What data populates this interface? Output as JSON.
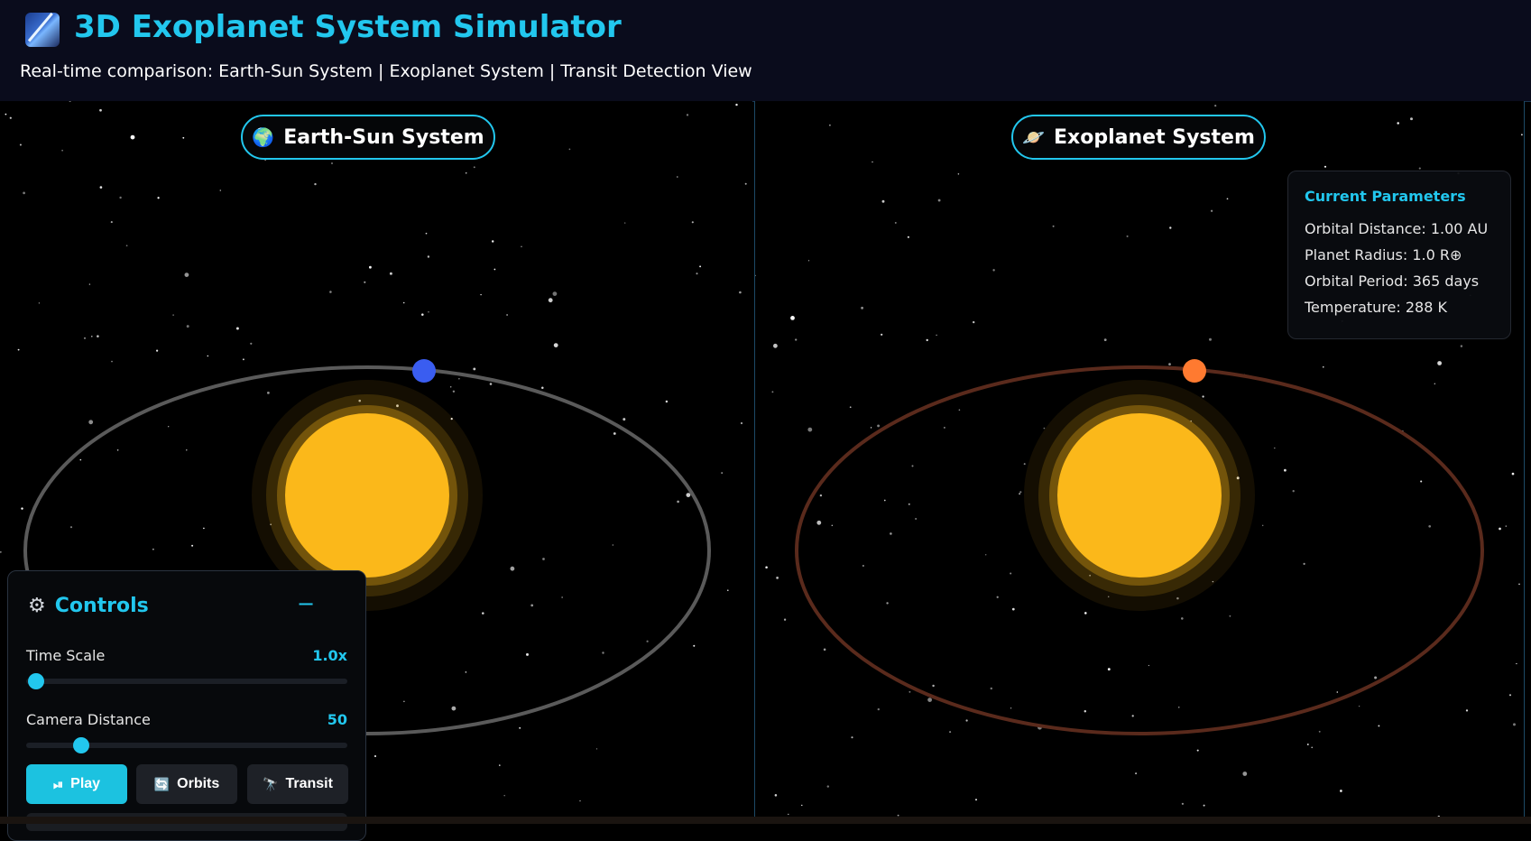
{
  "header": {
    "title": "3D Exoplanet System Simulator",
    "subtitle": "Real-time comparison: Earth-Sun System | Exoplanet System | Transit Detection View"
  },
  "left_panel": {
    "label": "Earth-Sun System",
    "icon": "globe-icon",
    "orbit_color": "#5a5a5a",
    "planet_color": "#3a5df0",
    "star_color": "#fbb81a"
  },
  "right_panel": {
    "label": "Exoplanet System",
    "icon": "ringed-planet-icon",
    "orbit_color": "#5a2a1c",
    "planet_color": "#ff7a30",
    "star_color": "#fbb81a",
    "parameters": {
      "title": "Current Parameters",
      "orbital_distance": "Orbital Distance: 1.00 AU",
      "planet_radius": "Planet Radius: 1.0 R⊕",
      "orbital_period": "Orbital Period: 365 days",
      "temperature": "Temperature: 288 K"
    }
  },
  "controls": {
    "title": "Controls",
    "collapse_symbol": "−",
    "time_scale": {
      "label": "Time Scale",
      "value": "1.0x",
      "position": 0.03
    },
    "camera_distance": {
      "label": "Camera Distance",
      "value": "50",
      "position": 0.17
    },
    "buttons": {
      "play": "Play",
      "orbits": "Orbits",
      "transit": "Transit"
    }
  },
  "colors": {
    "accent": "#22c7ee",
    "header_bg": "#0a0c1c"
  }
}
